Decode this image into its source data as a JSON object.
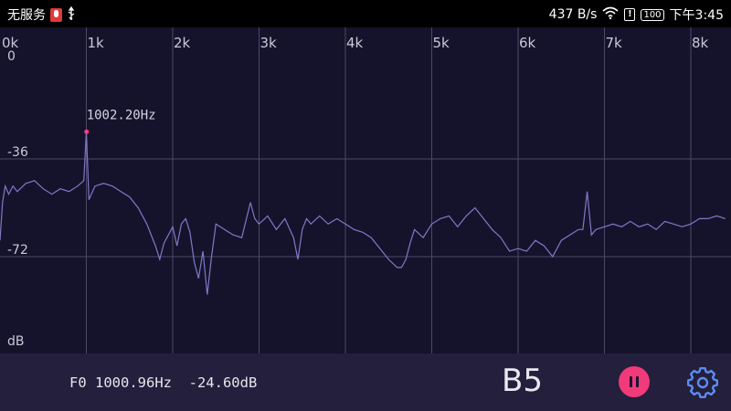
{
  "status_bar": {
    "carrier": "无服务",
    "net_speed": "437 B/s",
    "battery": "100",
    "time": "下午3:45",
    "icons": [
      "mic-icon",
      "usb-icon",
      "wifi-icon",
      "alert-icon",
      "battery-icon"
    ]
  },
  "spectrum": {
    "x_ticks": [
      "0k",
      "1k",
      "2k",
      "3k",
      "4k",
      "5k",
      "6k",
      "7k",
      "8k"
    ],
    "y_ticks": [
      "0",
      "-36",
      "-72"
    ],
    "y_unit": "dB",
    "peak_label": "1002.20Hz",
    "colors": {
      "background": "#15132b",
      "grid": "#4a4866",
      "trace": "#8078c8",
      "peak_marker": "#ff3a8a"
    }
  },
  "chart_data": {
    "type": "line",
    "xlabel": "",
    "ylabel": "dB",
    "xlim": [
      0,
      8.4
    ],
    "ylim": [
      -108,
      0
    ],
    "x_unit": "kHz",
    "grid": true,
    "peak": {
      "x": 1.0022,
      "y": -26
    },
    "x": [
      0,
      0.03,
      0.06,
      0.1,
      0.15,
      0.2,
      0.3,
      0.4,
      0.5,
      0.6,
      0.7,
      0.8,
      0.9,
      0.97,
      1.0,
      1.03,
      1.1,
      1.2,
      1.3,
      1.4,
      1.5,
      1.6,
      1.7,
      1.8,
      1.85,
      1.9,
      1.95,
      2.0,
      2.05,
      2.1,
      2.15,
      2.2,
      2.25,
      2.3,
      2.35,
      2.4,
      2.45,
      2.5,
      2.6,
      2.7,
      2.8,
      2.9,
      2.95,
      3.0,
      3.1,
      3.2,
      3.3,
      3.4,
      3.45,
      3.5,
      3.55,
      3.6,
      3.7,
      3.8,
      3.9,
      4.0,
      4.1,
      4.2,
      4.3,
      4.4,
      4.5,
      4.6,
      4.65,
      4.7,
      4.75,
      4.8,
      4.9,
      5.0,
      5.1,
      5.2,
      5.3,
      5.4,
      5.5,
      5.6,
      5.7,
      5.8,
      5.9,
      6.0,
      6.1,
      6.2,
      6.3,
      6.4,
      6.5,
      6.6,
      6.7,
      6.75,
      6.8,
      6.85,
      6.9,
      7.0,
      7.1,
      7.2,
      7.3,
      7.4,
      7.5,
      7.6,
      7.7,
      7.8,
      7.9,
      8.0,
      8.1,
      8.2,
      8.3,
      8.4
    ],
    "y": [
      -66,
      -52,
      -46,
      -49,
      -46,
      -48,
      -45,
      -44,
      -47,
      -49,
      -47,
      -48,
      -46,
      -44,
      -26,
      -51,
      -46,
      -45,
      -46,
      -48,
      -50,
      -54,
      -60,
      -68,
      -73,
      -67,
      -64,
      -61,
      -68,
      -60,
      -58,
      -63,
      -74,
      -80,
      -70,
      -86,
      -72,
      -60,
      -62,
      -64,
      -65,
      -52,
      -58,
      -60,
      -57,
      -62,
      -58,
      -65,
      -73,
      -62,
      -58,
      -60,
      -57,
      -60,
      -58,
      -60,
      -62,
      -63,
      -65,
      -69,
      -73,
      -76,
      -76,
      -73,
      -67,
      -62,
      -65,
      -60,
      -58,
      -57,
      -61,
      -57,
      -54,
      -58,
      -62,
      -65,
      -70,
      -69,
      -70,
      -66,
      -68,
      -72,
      -66,
      -64,
      -62,
      -62,
      -48,
      -64,
      -62,
      -61,
      -60,
      -61,
      -59,
      -61,
      -60,
      -62,
      -59,
      -60,
      -61,
      -60,
      -58,
      -58,
      -57,
      -58
    ]
  },
  "bottom_bar": {
    "f0_readout": "F0 1000.96Hz  -24.60dB",
    "note": "B5"
  }
}
